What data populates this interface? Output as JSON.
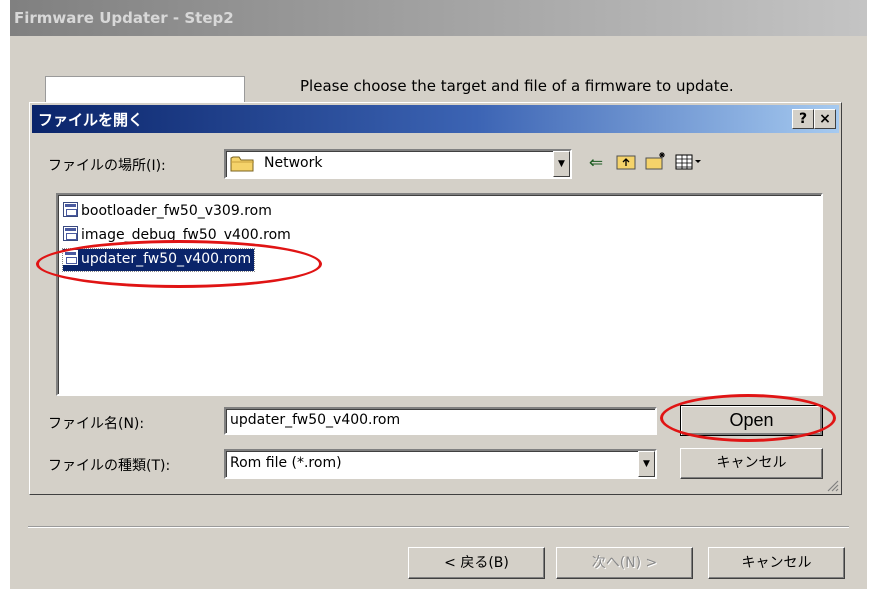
{
  "wizard": {
    "title": "Firmware Updater - Step2",
    "instruction": "Please choose the target and file of a firmware to update.",
    "back_button": "< 戻る(B)",
    "next_button": "次へ(N) >",
    "cancel_button": "キャンセル"
  },
  "dialog": {
    "title": "ファイルを開く",
    "help_button": "?",
    "close_button": "×",
    "look_in_label": "ファイルの場所(I):",
    "look_in_value": "Network",
    "files": [
      {
        "name": "bootloader_fw50_v309.rom",
        "selected": false
      },
      {
        "name": "image_debug_fw50_v400.rom",
        "selected": false
      },
      {
        "name": "updater_fw50_v400.rom",
        "selected": true
      }
    ],
    "filename_label": "ファイル名(N):",
    "filename_value": "updater_fw50_v400.rom",
    "filetype_label": "ファイルの種類(T):",
    "filetype_value": "Rom file (*.rom)",
    "open_button": "Open",
    "cancel_button": "キャンセル"
  },
  "icons": {
    "folder": "folder-icon",
    "back": "back-arrow-icon",
    "up": "up-folder-icon",
    "new_folder": "new-folder-icon",
    "view_menu": "view-menu-icon",
    "file": "rom-file-icon"
  },
  "colors": {
    "dialog_title_start": "#0a246a",
    "dialog_title_end": "#a6caf0",
    "selection": "#0a246a",
    "highlight_ring": "#e01414",
    "window_face": "#d4d0c8"
  }
}
